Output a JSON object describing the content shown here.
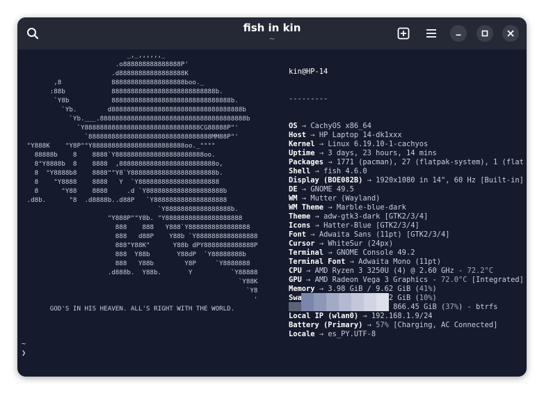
{
  "window": {
    "title": "fish in kin",
    "subtitle": "~"
  },
  "icons": {
    "search": "search-icon",
    "new_tab": "new-tab-icon",
    "menu": "hamburger-menu-icon",
    "minimize": "minimize-icon",
    "maximize": "maximize-icon",
    "close": "close-icon"
  },
  "art": {
    "lines": [
      "                           _,_,,,,,,_",
      "                        .o888888888888888P'",
      "                       .d88888888888888888K",
      "        ,8             8888888888888888888boo._",
      "       :88b            888888888888888888888888888b.",
      "        `Y8b           8888888888888888888888888888888b.",
      "          `Yb.        d8888888888888888888888888888888888b",
      "            `Yb.___.88888888888888888888888888888888888888b",
      "              `Y888888888888888888888888888888CG88888P\"'",
      "                `88888888888888888888888888888888MM88P\"'",
      " \"Y888K    \"Y8P\"\"Y888888888888888888888888oo._\"\"\"\"",
      "   88888b    8    8888`Y88888888888888888888888oo.",
      "   8\"Y8888b  8    8888  ,8888888888888888888888888o,",
      "   8  \"Y8888b8    8888\"\"Y8`Y8888888888888888888888b.",
      "   8    \"Y8888    8888   Y  `Y888888888888888888888",
      "   8      \"Y88    8888     .d `Y88888888888888888888b",
      " .d8b.      \"8  .d8888b..d88P   `Y8888888888888888888",
      "                                   `Y88888888888888888b.",
      "                      \"Y888P\"\"Y8b. \"Y88888888888888888888",
      "                        888    888   Y888`Y8888888888888888",
      "                        888   d88P    Y88b `Y8888888888888888",
      "                        888\"Y88K\"      Y88b dPY8888888888888P",
      "                        888  Y88b       Y88dP  `Y88888888b",
      "                        888   Y88b        Y8P     `Y8888888",
      "                      .d888b.  Y88b.       Y          `Y88888",
      "                                                        `Y88K",
      "                                                          `Y8",
      "                                                            '",
      "       GOD'S IN HIS HEAVEN. ALL'S RIGHT WITH THE WORLD."
    ]
  },
  "info": {
    "header": "kin@HP-14",
    "separator": "---------",
    "rows": [
      {
        "key": "OS",
        "value": "CachyOS x86_64"
      },
      {
        "key": "Host",
        "value": "HP Laptop 14-dk1xxx"
      },
      {
        "key": "Kernel",
        "value": "Linux 6.19.10-1-cachyos"
      },
      {
        "key": "Uptime",
        "value": "3 days, 23 hours, 14 mins"
      },
      {
        "key": "Packages",
        "value": "1771 (pacman), 27 (flatpak-system), 1 (flat"
      },
      {
        "key": "Shell",
        "value": "fish 4.6.0"
      },
      {
        "key": "Display (BOE082B)",
        "value": "1920x1080 in 14\", 60 Hz [Built-in]"
      },
      {
        "key": "DE",
        "value": "GNOME 49.5"
      },
      {
        "key": "WM",
        "value": "Mutter (Wayland)"
      },
      {
        "key": "WM Theme",
        "value": "Marble-blue-dark"
      },
      {
        "key": "Theme",
        "value": "adw-gtk3-dark [GTK2/3/4]"
      },
      {
        "key": "Icons",
        "value": "Hatter-Blue [GTK2/3/4]"
      },
      {
        "key": "Font",
        "value": "Adwaita Sans (11pt) [GTK2/3/4]"
      },
      {
        "key": "Cursor",
        "value": "WhiteSur (24px)"
      },
      {
        "key": "Terminal",
        "value": "GNOME Console 49.2"
      },
      {
        "key": "Terminal Font",
        "value": "Adwaita Mono (11pt)"
      },
      {
        "key": "CPU",
        "value": "AMD Ryzen 3 3250U (4) @ 2.60 GHz - ",
        "hl": "72.2°C",
        "after": ""
      },
      {
        "key": "GPU",
        "value": "AMD Radeon Vega 3 Graphics - ",
        "hl": "72.0°C",
        "after": " [Integrated]"
      },
      {
        "key": "Memory",
        "value": "3.98 GiB / 9.62 GiB (",
        "hl": "41%",
        "after": ")"
      },
      {
        "key": "Swap",
        "value": "982.43 MiB / 9.62 GiB (",
        "hl": "10%",
        "after": ")"
      },
      {
        "key": "Disk (/)",
        "value": "320.24 GiB / 866.45 GiB (",
        "hl": "37%",
        "after": ") - btrfs"
      },
      {
        "key": "Local IP (wlan0)",
        "value": "192.168.1.9/24"
      },
      {
        "key": "Battery (Primary)",
        "value": "",
        "hl": "57%",
        "after": " [Charging, AC Connected]"
      },
      {
        "key": "Locale",
        "value": "es_PY.UTF-8"
      }
    ],
    "arrow": "→"
  },
  "palette": {
    "colors": [
      "#5b6377",
      "#7a86ac",
      "#8e97b7",
      "#a2aac6",
      "#b3b9d1",
      "#c2c7db",
      "#d0d4e3",
      "#dddfe9"
    ]
  },
  "prompt": {
    "line1": "~",
    "line2": "❯"
  }
}
